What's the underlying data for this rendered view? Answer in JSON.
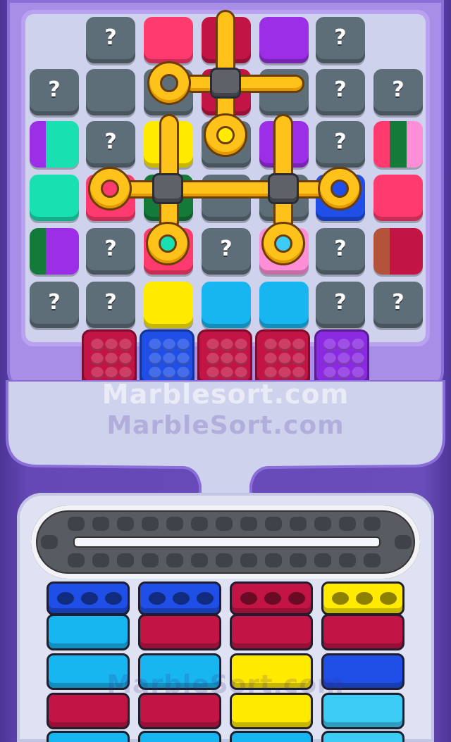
{
  "watermarks": [
    "Marblesort.com",
    "MarbleSort.com",
    "MarbleSort.com"
  ],
  "hidden_symbol": "?",
  "colors": {
    "pink": "#ff3a6e",
    "crimson": "#c21546",
    "purple": "#9b2ee6",
    "yellow": "#ffea00",
    "cyan": "#17b6f0",
    "blue": "#1f4fe6",
    "teal": "#19e0b0",
    "green": "#137a3a",
    "violet": "#8a2be2",
    "grey": "#5e6e78",
    "gold": "#ffc21a",
    "lightpink": "#ff8ed8",
    "brown": "#b4523a",
    "lightblue": "#3ccbf4"
  },
  "board": {
    "rows": [
      [
        "hidden",
        "pink",
        "crimson",
        "purple",
        "hidden",
        null
      ],
      [
        "hidden",
        "grey",
        "grey",
        "crimson",
        "grey",
        "hidden",
        "hidden"
      ],
      [
        "striped-purple-teal",
        "hidden",
        "yellow",
        "grey",
        "purple",
        "hidden",
        "striped-pink-green"
      ],
      [
        "teal",
        "pink",
        "green",
        "grey",
        "grey",
        "blue",
        "pink"
      ],
      [
        "striped-green-purple",
        "hidden",
        "pink",
        "hidden",
        "lightpink",
        "hidden",
        "striped-brown-crimson"
      ],
      [
        "hidden",
        "hidden",
        "yellow",
        "cyan",
        "cyan",
        "hidden",
        "hidden"
      ]
    ]
  },
  "marble_boxes": [
    "crimson",
    "blue",
    "crimson",
    "crimson",
    "violet"
  ],
  "queue_columns": [
    [
      "blue",
      "cyan",
      "cyan",
      "crimson",
      "cyan"
    ],
    [
      "blue",
      "crimson",
      "cyan",
      "crimson",
      "cyan"
    ],
    [
      "crimson",
      "crimson",
      "yellow",
      "yellow",
      "cyan"
    ],
    [
      "yellow",
      "crimson",
      "blue",
      "lightblue",
      "lightblue"
    ]
  ]
}
